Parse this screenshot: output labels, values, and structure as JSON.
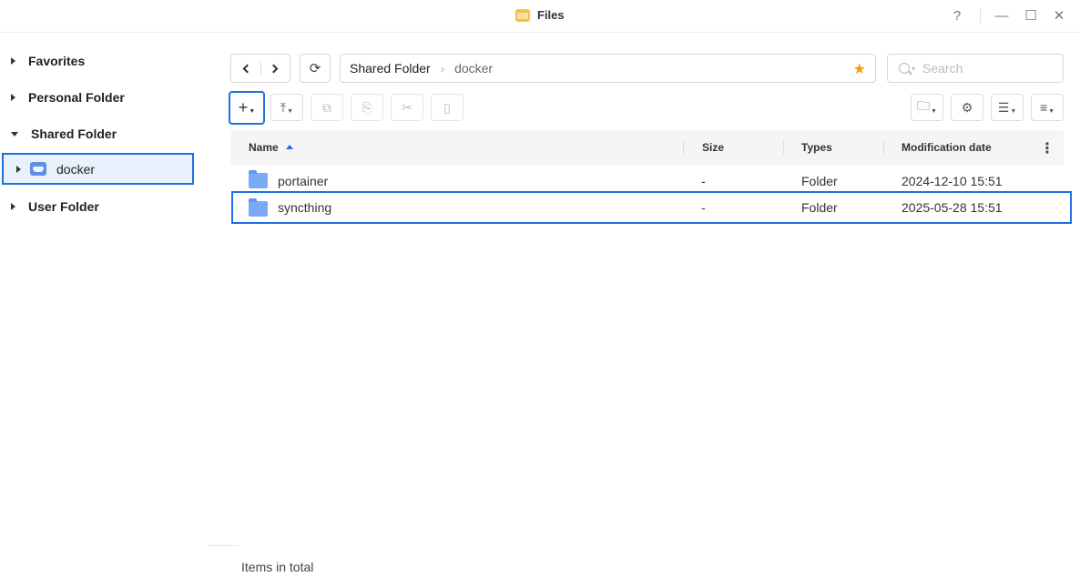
{
  "window": {
    "title": "Files"
  },
  "window_controls": {
    "help": "?",
    "minimize": "—",
    "maximize": "☐",
    "close": "✕"
  },
  "sidebar": {
    "items": [
      {
        "label": "Favorites",
        "expanded": false
      },
      {
        "label": "Personal Folder",
        "expanded": false
      },
      {
        "label": "Shared Folder",
        "expanded": true
      },
      {
        "label": "User Folder",
        "expanded": false
      }
    ],
    "selected_child": {
      "label": "docker",
      "icon": "docker-folder-icon"
    }
  },
  "path": {
    "crumbs": [
      "Shared Folder",
      "docker"
    ],
    "favorite_color": "#f39c12"
  },
  "search": {
    "placeholder": "Search",
    "value": ""
  },
  "toolbar": {
    "new": "+",
    "upload": "⤒",
    "copy": "⧉",
    "paste": "⎘",
    "cut": "✂",
    "rename": "▯",
    "action": "🗀",
    "settings": "⚙",
    "view": "☰",
    "sort": "≡"
  },
  "table": {
    "columns": [
      "Name",
      "Size",
      "Types",
      "Modification date"
    ],
    "sort": {
      "column": "Name",
      "direction": "ascending"
    },
    "rows": [
      {
        "name": "portainer",
        "size": "-",
        "type": "Folder",
        "modified": "2024-12-10 15:51"
      },
      {
        "name": "syncthing",
        "size": "-",
        "type": "Folder",
        "modified": "2025-05-28 15:51"
      }
    ]
  },
  "footer": {
    "status": "Items in total"
  },
  "colors": {
    "accent": "#1e6fe0",
    "selection_bg": "#e8f1fc",
    "folder": "#7aaaf5"
  }
}
